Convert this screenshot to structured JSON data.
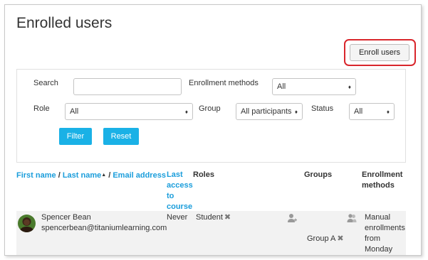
{
  "page": {
    "title": "Enrolled users",
    "enroll_button": "Enroll users"
  },
  "filters": {
    "search_label": "Search",
    "search_value": "",
    "enrollment_methods_label": "Enrollment methods",
    "enrollment_methods_value": "All",
    "role_label": "Role",
    "role_value": "All",
    "group_label": "Group",
    "group_value": "All participants",
    "status_label": "Status",
    "status_value": "All",
    "filter_button": "Filter",
    "reset_button": "Reset"
  },
  "table": {
    "headers": {
      "first_name": "First name",
      "slash1": " / ",
      "last_name": "Last name",
      "sort_arrow": "▲",
      "slash2": " / ",
      "email": "Email address",
      "last_access": [
        "Last",
        "access",
        "to",
        "course"
      ],
      "roles": "Roles",
      "groups": "Groups",
      "enrollment_methods": [
        "Enrollment",
        "methods"
      ]
    },
    "rows": [
      {
        "name": "Spencer Bean",
        "email": "spencerbean@titaniumlearning.com",
        "last_access": "Never",
        "role": "Student",
        "group": "Group A",
        "enrollment_lines": [
          "Manual",
          "enrollments",
          "from",
          "Monday"
        ]
      }
    ]
  },
  "icons": {
    "remove": "✖",
    "caret": "♦",
    "add_role": "user-plus-icon",
    "add_group": "users-icon",
    "enrollment_user": "user-icon"
  },
  "colors": {
    "link": "#1a9ddb",
    "primary_button": "#1ab1e6",
    "highlight": "#d9262c"
  }
}
